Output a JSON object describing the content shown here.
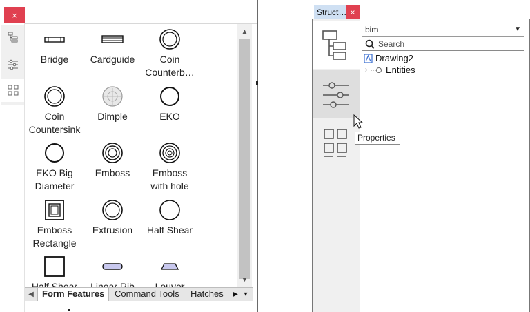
{
  "left_panel": {
    "close_label": "×",
    "items": [
      {
        "label": "Bridge",
        "icon": "bridge-icon"
      },
      {
        "label": "Cardguide",
        "icon": "cardguide-icon"
      },
      {
        "label": "Coin\nCounterb…",
        "icon": "coin-counterbore-icon"
      },
      {
        "label": "Coin\nCountersink",
        "icon": "coin-countersink-icon"
      },
      {
        "label": "Dimple",
        "icon": "dimple-icon"
      },
      {
        "label": "EKO",
        "icon": "eko-icon"
      },
      {
        "label": "EKO Big\nDiameter",
        "icon": "eko-big-diameter-icon"
      },
      {
        "label": "Emboss",
        "icon": "emboss-icon"
      },
      {
        "label": "Emboss\nwith hole",
        "icon": "emboss-with-hole-icon"
      },
      {
        "label": "Emboss\nRectangle",
        "icon": "emboss-rectangle-icon"
      },
      {
        "label": "Extrusion",
        "icon": "extrusion-icon"
      },
      {
        "label": "Half Shear",
        "icon": "half-shear-icon"
      },
      {
        "label": "Half Shear",
        "icon": "half-shear-rectangle-icon"
      },
      {
        "label": "Linear Rib",
        "icon": "linear-rib-icon"
      },
      {
        "label": "Louver",
        "icon": "louver-icon"
      }
    ],
    "tabs": [
      {
        "label": "Form Features",
        "active": true
      },
      {
        "label": "Command Tools",
        "active": false
      },
      {
        "label": "Hatches",
        "active": false
      }
    ]
  },
  "right_panel": {
    "tab_title": "Struct…",
    "close_label": "×",
    "combo_value": "bim",
    "search_placeholder": "Search",
    "tree": [
      {
        "label": "Drawing2",
        "icon": "drawing-file-icon"
      },
      {
        "label": "Entities",
        "icon": "entity-node-icon"
      }
    ],
    "tooltip": "Properties"
  },
  "colors": {
    "close_red": "#e04050",
    "tab_blue": "#cfe0f3",
    "rail_gray": "#f0f0f0"
  }
}
